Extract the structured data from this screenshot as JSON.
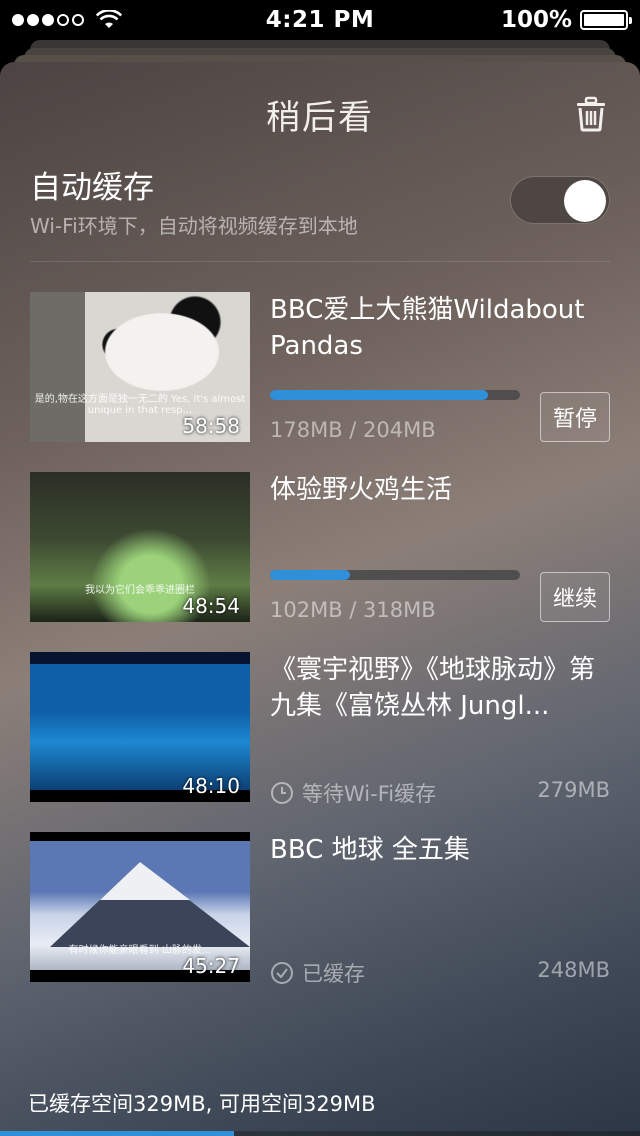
{
  "status_bar": {
    "time": "4:21 PM",
    "battery": "100%",
    "signal_bars_on": 3,
    "signal_bars_total": 5
  },
  "header": {
    "title": "稍后看",
    "trash_icon": "trash-icon"
  },
  "auto_cache": {
    "title": "自动缓存",
    "subtitle": "Wi-Fi环境下，自动将视频缓存到本地",
    "enabled": true
  },
  "videos": [
    {
      "title": "BBC爱上大熊猫Wildabout Pandas",
      "duration": "58:58",
      "thumb_caption": "是的,物在这方面是独一无二的 Yes, it's almost unique in that resp...",
      "progress": 0.873,
      "size_text": "178MB / 204MB",
      "action": "暂停"
    },
    {
      "title": "体验野火鸡生活",
      "duration": "48:54",
      "thumb_caption": "我以为它们会乖乖进圈栏",
      "progress": 0.321,
      "size_text": "102MB / 318MB",
      "action": "继续"
    },
    {
      "title": "《寰宇视野》《地球脉动》第九集《富饶丛林 Jungl...",
      "duration": "48:10",
      "status": "等待Wi-Fi缓存",
      "status_icon": "clock-icon",
      "size": "279MB"
    },
    {
      "title": "BBC 地球 全五集",
      "duration": "45:27",
      "thumb_caption": "有时候你能亲眼看到 山脉的发...",
      "status": "已缓存",
      "status_icon": "check-circle-icon",
      "size": "248MB"
    }
  ],
  "footer": {
    "storage_text": "已缓存空间329MB, 可用空间329MB",
    "usage_fraction": 0.365
  },
  "colors": {
    "accent": "#2f8fd8"
  }
}
